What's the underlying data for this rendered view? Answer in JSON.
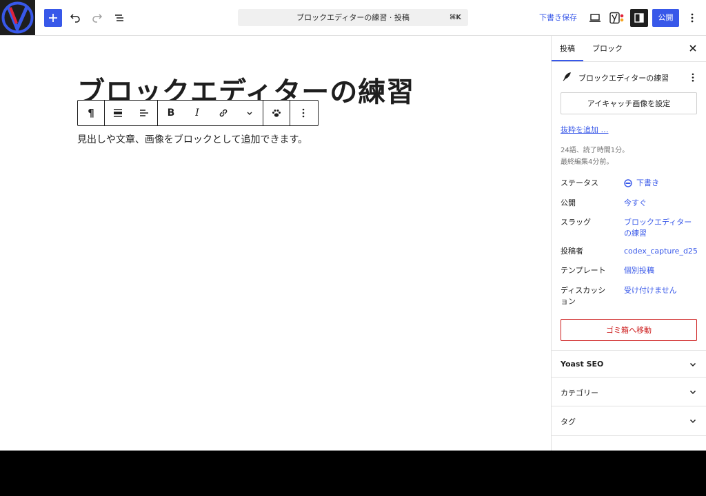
{
  "header": {
    "command_title": "ブロックエディターの練習 · 投稿",
    "command_shortcut": "⌘K",
    "save_draft_label": "下書き保存",
    "publish_label": "公開"
  },
  "editor": {
    "post_title": "ブロックエディターの練習",
    "paragraph": "見出しや文章、画像をブロックとして追加できます。"
  },
  "block_toolbar": {
    "paragraph_icon": "¶",
    "bold_label": "B",
    "italic_label": "I"
  },
  "sidebar": {
    "tabs": [
      {
        "label": "投稿"
      },
      {
        "label": "ブロック"
      }
    ],
    "post_summary_title": "ブロックエディターの練習",
    "featured_image_label": "アイキャッチ画像を設定",
    "excerpt_link": "抜粋を追加 …",
    "stats_words": "24語、読了時間1分。",
    "stats_edited": "最終編集4分前。",
    "meta": [
      {
        "label": "ステータス",
        "value": "下書き"
      },
      {
        "label": "公開",
        "value": "今すぐ"
      },
      {
        "label": "スラッグ",
        "value": "ブロックエディターの練習"
      },
      {
        "label": "投稿者",
        "value": "codex_capture_d25"
      },
      {
        "label": "テンプレート",
        "value": "個別投稿"
      },
      {
        "label": "ディスカッション",
        "value": "受け付けません"
      }
    ],
    "trash_label": "ゴミ箱へ移動",
    "panels": [
      {
        "title": "Yoast SEO"
      },
      {
        "title": "カテゴリー"
      },
      {
        "title": "タグ"
      }
    ]
  },
  "colors": {
    "accent": "#3858e9",
    "danger": "#cc1818",
    "text": "#1e1e1e"
  }
}
